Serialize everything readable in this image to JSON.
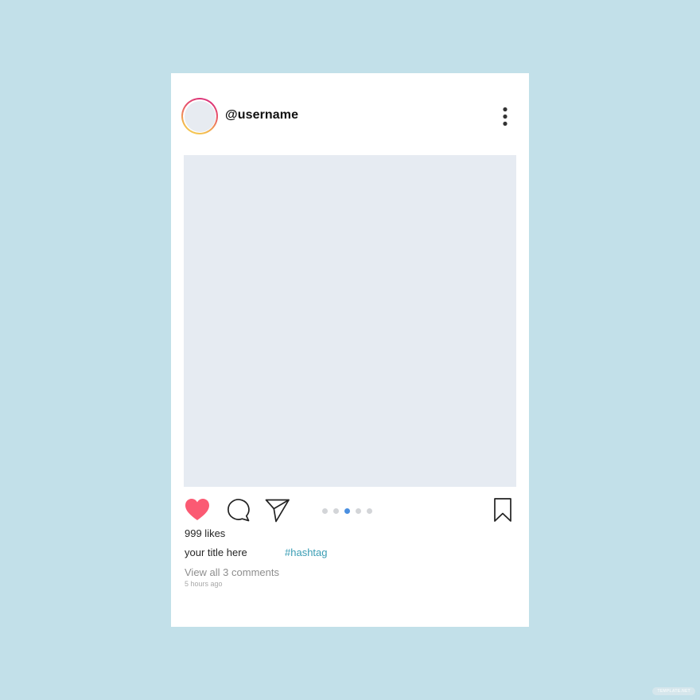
{
  "post": {
    "username": "@username",
    "likes": "999 likes",
    "caption_title": "your title here",
    "hashtag": "#hashtag",
    "view_comments": "View all 3 comments",
    "timestamp": "5 hours ago",
    "carousel": {
      "total": 5,
      "active_index": 2
    },
    "liked": true
  },
  "icons": {
    "more": "more-vertical-icon",
    "like": "heart-icon",
    "comment": "speech-bubble-icon",
    "share": "paper-plane-icon",
    "save": "bookmark-icon"
  },
  "colors": {
    "background": "#c2e0e9",
    "card": "#ffffff",
    "media_placeholder": "#e6ebf2",
    "heart": "#fb5a73",
    "hashtag": "#3a9db4",
    "active_dot": "#4a8fe0",
    "inactive_dot": "#d3d5d8"
  },
  "watermark": "TEMPLATE.NET"
}
